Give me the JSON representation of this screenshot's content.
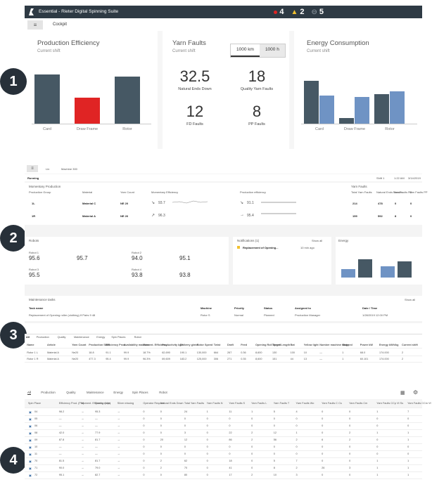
{
  "app": {
    "title": "Essential - Rieter Digital Spinning Suite",
    "alerts": [
      {
        "count": "4",
        "color": "#e02424"
      },
      {
        "count": "2",
        "color": "#f2c12e"
      },
      {
        "count": "5",
        "color": "#9aa4ad"
      }
    ]
  },
  "nav": {
    "menu_icon": "≡",
    "crumb": "Cockpit"
  },
  "badges": [
    "1",
    "2",
    "3",
    "4"
  ],
  "production_efficiency": {
    "title": "Production Efficiency",
    "subtitle": "Current shift",
    "chart_data": {
      "type": "bar",
      "categories": [
        "Card",
        "Draw Frame",
        "Rotor"
      ],
      "values": [
        88,
        46,
        84
      ],
      "colors": [
        "#465864",
        "#e02424",
        "#465864"
      ],
      "ylim": [
        0,
        100
      ]
    }
  },
  "yarn_faults": {
    "title": "Yarn Faults",
    "subtitle": "Current shift",
    "toggle": [
      "1000 km",
      "1000 h"
    ],
    "kpis": [
      {
        "value": "32.5",
        "label": "Natural Ends Down"
      },
      {
        "value": "18",
        "label": "Quality Yarn Faults"
      },
      {
        "value": "12",
        "label": "FD Faults"
      },
      {
        "value": "8",
        "label": "PP Faults"
      }
    ]
  },
  "energy": {
    "title": "Energy Consumption",
    "subtitle": "Current shift",
    "chart_data": {
      "type": "bar",
      "categories": [
        "Card",
        "Draw Frame",
        "Rotor"
      ],
      "series": [
        {
          "values": [
            76,
            10,
            52
          ],
          "color": "#465864"
        },
        {
          "values": [
            50,
            48,
            58
          ],
          "color": "#6f93c4"
        }
      ],
      "ylim": [
        0,
        100
      ]
    }
  },
  "machine": {
    "crumb_1": "Lin",
    "crumb_2": "Machine 300",
    "status": "Running",
    "shift": "Shift 1",
    "time": "1:22 AM",
    "date": "3/14/2019",
    "mp_title": "Momentary Production",
    "mp_headers": [
      "Production Group",
      "Material",
      "Yarn Count",
      "Momentary Efficiency",
      "Production efficiency"
    ],
    "mp_rows": [
      {
        "group": "1L",
        "material": "Material C",
        "count": "NE 20",
        "eff": "93.7",
        "prod": "91.1"
      },
      {
        "group": "1R",
        "material": "Material A",
        "count": "NE 26",
        "eff": "96.3",
        "prod": "95.4"
      }
    ],
    "yf_title": "Yarn Faults",
    "yf_headers": [
      "Total Yarn Faults",
      "Natural Ends Breaks",
      "Yarn Faults FD",
      "Yarn Faults PP"
    ],
    "yf_rows": [
      [
        "214",
        "478",
        "0",
        "0"
      ],
      [
        "159",
        "592",
        "8",
        "0"
      ]
    ],
    "robots_title": "Robots",
    "robots": [
      {
        "name": "Robot 1",
        "a": "95.6",
        "b": "95.7"
      },
      {
        "name": "Robot 2",
        "a": "94.0",
        "b": "95.1"
      },
      {
        "name": "Robot 3",
        "a": "95.5",
        "b": ""
      },
      {
        "name": "Robot 4",
        "a": "93.8",
        "b": "93.8"
      }
    ],
    "notifications_title": "Notifications (1)",
    "notifications_link": "Show all",
    "notification": "Replacement of Opening...",
    "notification_time": "10 min ago",
    "energy_title": "Energy",
    "maint_title": "Maintenance tasks",
    "maint_link": "Show all",
    "maint_headers": [
      "Task name",
      "Machine",
      "Priority",
      "Status",
      "Assigned to",
      "Date / Time"
    ],
    "maint_row": [
      "Replacement of Opening roller (clothing) If Pairs 9 48",
      "Rotor S",
      "Normal",
      "Planned",
      "Production Manager",
      "1/28/2019 12:00 PM"
    ]
  },
  "table3": {
    "tabs": [
      "All",
      "Production",
      "Quality",
      "Maintenance",
      "Energy",
      "Spin Places",
      "Robot"
    ],
    "headers": [
      "Name",
      "Article",
      "Yarn Count",
      "Production Shift",
      "Efficiency Prod.",
      "Availability machine",
      "Moment. Efficiency",
      "Productivity kg/h",
      "Delivery g/min",
      "Rotor Speed",
      "Twist",
      "Draft",
      "Feed",
      "Opening Roll Speed",
      "Target Length",
      "Bat",
      "Yellow light",
      "Number machine stopped",
      "State",
      "Power kW",
      "Energy kWh/kg",
      "Current shift"
    ],
    "rows": [
      [
        "Rotor 1 L",
        "Material A",
        "Ne20",
        "18.8",
        "91.1",
        "99.9",
        "18.7%",
        "62,690",
        "190.1",
        "130,000",
        "664",
        "267",
        "0.36",
        "8,600",
        "130",
        "100",
        "10",
        "—",
        "1",
        "68.0",
        "174.000",
        "2"
      ],
      [
        "Rotor 1 R",
        "Material A",
        "Ne20",
        "477.3",
        "95.4",
        "99.9",
        "96.3%",
        "69,609",
        "183.2",
        "125,000",
        "306",
        "271",
        "0.35",
        "8,600",
        "151",
        "44",
        "13",
        "—",
        "1",
        "60.101",
        "174.000",
        "2"
      ]
    ]
  },
  "table4": {
    "tabs": [
      "All",
      "Production",
      "Quality",
      "Maintenance",
      "Energy",
      "Spin Places",
      "Robot"
    ],
    "headers": [
      "Spin Place",
      "Efficiency Prod. (Pfa)",
      "Moment. Efficiency (Idle)",
      "Quality stops",
      "Silver missing",
      "Operator Request",
      "Natural Ends Down",
      "Total Yarn Faults",
      "Yarn Faults N",
      "Yarn Faults S",
      "Yarn Faults L",
      "Yarn Faults T",
      "Yarn Faults Wo",
      "Yarn Faults C Cs",
      "Yarn Faults Cm",
      "Yarn Faults CCp Vt Ss",
      "Yarn Faults CCm Vt Tc"
    ],
    "rows": [
      [
        "04",
        "98.2",
        "→",
        "95.3",
        "→",
        "0",
        "0",
        "24",
        "1",
        "11",
        "1",
        "5",
        "4",
        "0",
        "0",
        "1",
        "7"
      ],
      [
        "05",
        "—",
        "→",
        "—",
        "→",
        "0",
        "0",
        "0",
        "0",
        "0",
        "0",
        "0",
        "0",
        "0",
        "0",
        "0",
        "0"
      ],
      [
        "06",
        "—",
        "→",
        "—",
        "→",
        "0",
        "0",
        "0",
        "0",
        "0",
        "0",
        "0",
        "0",
        "0",
        "0",
        "0",
        "0"
      ],
      [
        "08",
        "42.0",
        "→",
        "77.9",
        "→",
        "0",
        "0",
        "3",
        "0",
        "22",
        "2",
        "12",
        "1",
        "0",
        "2",
        "1",
        "1"
      ],
      [
        "09",
        "87.8",
        "→",
        "81.7",
        "→",
        "0",
        "20",
        "12",
        "0",
        "86",
        "2",
        "56",
        "2",
        "6",
        "2",
        "0",
        "1"
      ],
      [
        "10",
        "—",
        "→",
        "—",
        "→",
        "0",
        "0",
        "0",
        "0",
        "0",
        "0",
        "0",
        "0",
        "0",
        "0",
        "0",
        "0"
      ],
      [
        "11",
        "—",
        "→",
        "—",
        "→",
        "0",
        "0",
        "0",
        "0",
        "0",
        "0",
        "0",
        "0",
        "0",
        "0",
        "0",
        "0"
      ],
      [
        "70",
        "81.5",
        "→",
        "81.7",
        "→",
        "0",
        "2",
        "62",
        "0",
        "18",
        "0",
        "5",
        "7",
        "0",
        "0",
        "1",
        "1"
      ],
      [
        "71",
        "90.0",
        "→",
        "79.0",
        "→",
        "0",
        "2",
        "70",
        "0",
        "41",
        "0",
        "8",
        "2",
        "26",
        "3",
        "1",
        "1"
      ],
      [
        "72",
        "95.1",
        "→",
        "82.7",
        "→",
        "0",
        "0",
        "80",
        "0",
        "17",
        "2",
        "10",
        "3",
        "0",
        "0",
        "1",
        "1"
      ]
    ]
  }
}
